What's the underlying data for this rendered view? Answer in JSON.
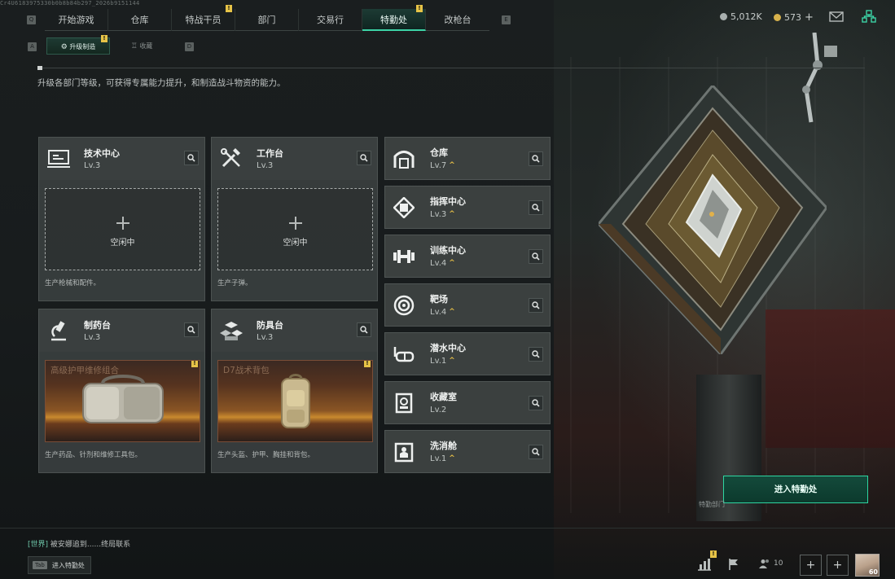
{
  "system_line": "Cr4U6183975330b0b8b84b297_2026b9151144",
  "topnav": {
    "tabs": [
      {
        "label": "开始游戏",
        "badge": ""
      },
      {
        "label": "仓库",
        "badge": ""
      },
      {
        "label": "特战干员",
        "badge": "!"
      },
      {
        "label": "部门",
        "badge": ""
      },
      {
        "label": "交易行",
        "badge": ""
      },
      {
        "label": "特勤处",
        "badge": "!",
        "active": true
      },
      {
        "label": "改枪台",
        "badge": ""
      }
    ],
    "hotkey_left": "Q",
    "hotkey_right": "E"
  },
  "currency": {
    "silver": "5,012K",
    "gold": "573",
    "gold_add": "+",
    "colors": {
      "silver": "#a9b0af",
      "gold": "#d7b24c"
    }
  },
  "subtabs": {
    "items": [
      {
        "label": "升级制造",
        "icon": "gear-icon",
        "badge": "!",
        "active": true
      },
      {
        "label": "收藏",
        "icon": "trophy-icon",
        "badge": ""
      }
    ],
    "hotkey_left": "A",
    "hotkey_right": "D"
  },
  "description": "升级各部门等级，可获得专属能力提升，和制造战斗物资的能力。",
  "production_cards": [
    {
      "name": "技术中心",
      "level": "Lv.3",
      "icon": "computer-icon",
      "slot_state": "idle",
      "idle_label": "空闲中",
      "footer": "生产枪械和配件。"
    },
    {
      "name": "工作台",
      "level": "Lv.3",
      "icon": "tools-icon",
      "slot_state": "idle",
      "idle_label": "空闲中",
      "footer": "生产子弹。"
    },
    {
      "name": "制药台",
      "level": "Lv.3",
      "icon": "microscope-icon",
      "slot_state": "producing",
      "product": "高级护甲维修组合",
      "product_badge": "!",
      "footer": "生产药品、针剂和维修工具包。"
    },
    {
      "name": "防具台",
      "level": "Lv.3",
      "icon": "boxes-icon",
      "slot_state": "producing",
      "product": "D7战术背包",
      "product_badge": "!",
      "footer": "生产头盔、护甲、胸挂和背包。"
    }
  ],
  "departments": [
    {
      "name": "仓库",
      "level": "Lv.7",
      "upgrade": "^",
      "icon": "warehouse-icon"
    },
    {
      "name": "指挥中心",
      "level": "Lv.3",
      "upgrade": "^",
      "icon": "chip-icon"
    },
    {
      "name": "训练中心",
      "level": "Lv.4",
      "upgrade": "^",
      "icon": "dumbbell-icon"
    },
    {
      "name": "靶场",
      "level": "Lv.4",
      "upgrade": "^",
      "icon": "target-icon"
    },
    {
      "name": "潜水中心",
      "level": "Lv.1",
      "upgrade": "^",
      "icon": "diving-mask-icon"
    },
    {
      "name": "收藏室",
      "level": "Lv.2",
      "upgrade": "",
      "icon": "display-case-icon"
    },
    {
      "name": "洗消舱",
      "level": "Lv.1",
      "upgrade": "^",
      "icon": "hazmat-icon"
    }
  ],
  "enter_button": "进入特勤处",
  "scene_sign": "特勤部门",
  "chat": {
    "channel": "[世界]",
    "text": "被安娜追到......终局联系"
  },
  "tab_hint": {
    "key": "Tab",
    "label": "进入特勤处"
  },
  "bottom": {
    "friends": "10",
    "avatar_level": "60",
    "stats_badge": "!"
  },
  "accent_color": "#3cd3a6",
  "upgrade_color": "#e7bf46"
}
